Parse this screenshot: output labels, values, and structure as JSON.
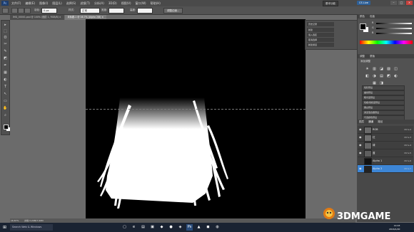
{
  "menubar": {
    "app_logo": "Ps",
    "items": [
      "文件(F)",
      "编辑(E)",
      "图像(I)",
      "图层(L)",
      "选择(S)",
      "滤镜(T)",
      "分析(A)",
      "3D(D)",
      "视图(V)",
      "窗口(W)",
      "帮助(H)"
    ],
    "workspace": "基本功能",
    "cs_live": "CS Live",
    "controls": [
      "–",
      "□",
      "×"
    ]
  },
  "options_bar": {
    "feather_label": "羽化:",
    "feather_value": "0 px",
    "style_label": "样式:",
    "style_value": "正常",
    "width_label": "宽度:",
    "height_label": "高度:",
    "refine_edge": "调整边缘..."
  },
  "tabs": [
    {
      "label": "IMG_00001.psd @ 100% (图层 1, RGB/8) ×",
      "active": false
    },
    {
      "label": "未标题-1 @ 16.7% (Alpha 2/8) ×",
      "active": true
    }
  ],
  "tools": [
    "▸",
    "⬚",
    "ʘ",
    "✂",
    "✎",
    "◩",
    "✒",
    "▦",
    "◐",
    "T",
    "↖",
    "▭",
    "✋",
    "⌕"
  ],
  "history": {
    "title": "历史记录",
    "items": [
      "新建",
      "载入选区",
      "取消选择",
      "新建通道"
    ]
  },
  "color_panel": {
    "title": "颜色",
    "tab2": "色板",
    "r_label": "R",
    "g_label": "G",
    "b_label": "B",
    "r_value": "0",
    "g_value": "0",
    "b_value": "0"
  },
  "adjustments": {
    "title": "调整",
    "tab2": "蒙版",
    "subtitle": "添加调整",
    "icons": [
      "☀",
      "▥",
      "◪",
      "▨",
      "◫",
      "◧",
      "◑",
      "▤",
      "◩",
      "◐",
      "▦",
      "◨"
    ],
    "presets": [
      "色阶预设",
      "曲线预设",
      "曝光度预设",
      "色相/饱和度预设",
      "黑白预设",
      "通道混合器预设",
      "可选颜色预设"
    ]
  },
  "layers_panel": {
    "title": "通道",
    "tab1": "图层",
    "tab3": "路径",
    "channels": [
      {
        "name": "RGB",
        "key": "Ctrl+2",
        "selected": false
      },
      {
        "name": "红",
        "key": "Ctrl+3",
        "selected": false
      },
      {
        "name": "绿",
        "key": "Ctrl+4",
        "selected": false
      },
      {
        "name": "蓝",
        "key": "Ctrl+5",
        "selected": false
      },
      {
        "name": "Alpha 1",
        "key": "Ctrl+6",
        "selected": false
      },
      {
        "name": "Alpha 2",
        "key": "Ctrl+7",
        "selected": true
      }
    ]
  },
  "status": {
    "zoom": "16.67%",
    "doc": "文档:3.20M/7.99M"
  },
  "taskbar": {
    "search_placeholder": "Search Web & Windows",
    "time": "14:43",
    "date": "2016/1/20"
  },
  "watermark": "3DMGAME"
}
